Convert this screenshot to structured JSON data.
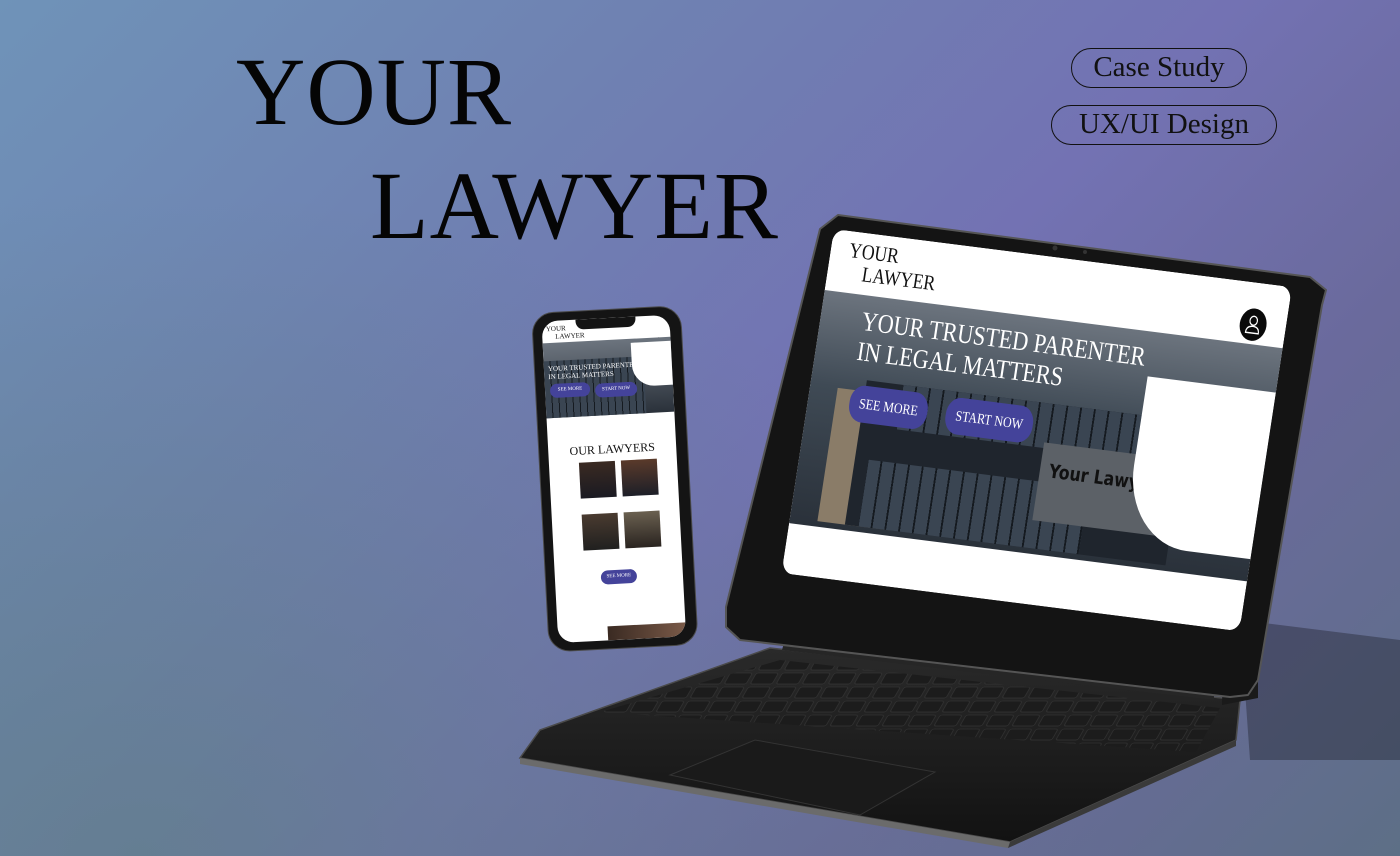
{
  "title": {
    "line1": "YOUR",
    "line2": "LAWYER"
  },
  "tags": [
    "Case Study",
    "UX/UI Design"
  ],
  "tablet": {
    "logo_line1": "YOUR",
    "logo_line2": "LAWYER",
    "hero_line1": "YOUR TRUSTED PARENTER",
    "hero_line2": "IN LEGAL MATTERS",
    "see_more": "SEE MORE",
    "start_now": "START NOW",
    "building_sign": "Your Lawyar"
  },
  "phone": {
    "logo_line1": "YOUR",
    "logo_line2": "LAWYER",
    "hero_line1": "YOUR TRUSTED PARENTER",
    "hero_line2": "IN LEGAL MATTERS",
    "see_more": "SEE MORE",
    "start_now": "START NOW",
    "section_title": "OUR LAWYERS",
    "section_button": "SEE MORE"
  },
  "colors": {
    "accent": "#44439a",
    "device": "#141414"
  }
}
